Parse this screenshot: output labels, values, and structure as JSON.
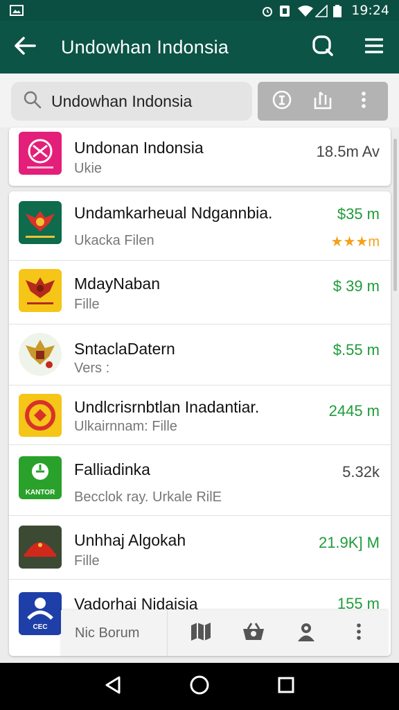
{
  "status_bar": {
    "time": "19:24"
  },
  "toolbar": {
    "title": "Undowhan Indonsia"
  },
  "search": {
    "query": "Undowhan Indonsia"
  },
  "top_result": {
    "name": "Undonan Indonsia",
    "subtitle": "Ukie",
    "meta": "18.5m Av"
  },
  "apps": [
    {
      "name": "Undamkarheual Ndgannbia.",
      "subtitle": "Ukacka Filen",
      "meta": "$35 m",
      "meta_color": "green",
      "stars": "★★★m"
    },
    {
      "name": "MdayNaban",
      "subtitle": "Fille",
      "meta": "$ 39 m",
      "meta_color": "green"
    },
    {
      "name": "SntaclaDatern",
      "subtitle": "Vers :",
      "meta": "$.55 m",
      "meta_color": "green"
    },
    {
      "name": "Undlcrisrnbtlan Inadantiar.",
      "subtitle": "Ulkairnnam: Fille",
      "meta": "2445 m",
      "meta_color": "green"
    },
    {
      "name": "Falliadinka",
      "subtitle": "Becclok ray. Urkale RilE",
      "meta": "5.32k",
      "meta_color": "gray"
    },
    {
      "name": "Unhhaj Algokah",
      "subtitle": "Fille",
      "meta": "21.9K] M",
      "meta_color": "green"
    },
    {
      "name": "Vadorhai Nidaisia",
      "subtitle": "",
      "meta": "155 m",
      "meta_color": "green"
    }
  ],
  "icon_labels": {
    "kantor": "KANTOR",
    "box": "CEC"
  },
  "bottom_overlay": {
    "label": "Nic Borum"
  },
  "colors": {
    "header": "#0b5446",
    "status": "#0b4f42",
    "green": "#1e9b3a",
    "star": "#f3a11a"
  }
}
